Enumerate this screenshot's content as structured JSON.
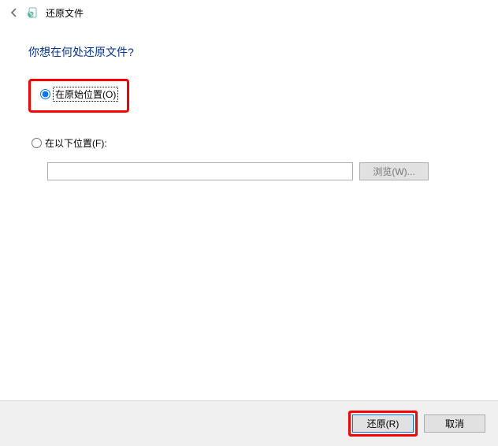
{
  "header": {
    "title": "还原文件"
  },
  "content": {
    "question": "你想在何处还原文件?",
    "options": {
      "original": "在原始位置(O)",
      "custom": "在以下位置(F):"
    },
    "path_value": "",
    "browse_label": "浏览(W)..."
  },
  "footer": {
    "restore_label": "还原(R)",
    "cancel_label": "取消"
  }
}
